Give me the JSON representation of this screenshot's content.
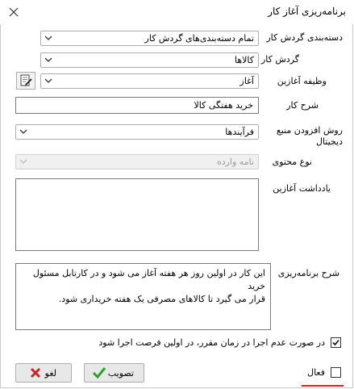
{
  "window": {
    "title": "برنامه‌ریزی آغاز کار"
  },
  "form": {
    "category": {
      "label": "دسته‌بندی گردش کار",
      "value": "تمام دسته‌بندی‌های گردش کار"
    },
    "workflow": {
      "label": "گردش کار",
      "value": "کالاها"
    },
    "start_task": {
      "label": "وظیفه آغازین",
      "value": "آغاز"
    },
    "description": {
      "label": "شرح کار",
      "value": "خرید هفتگی کالا"
    },
    "digital_resource_method": {
      "label": "روش افزودن منبع دیجیتال",
      "value": "فرآیندها"
    },
    "content_type": {
      "label": "نوع محتوی",
      "value": "نامه وارده"
    },
    "start_note": {
      "label": "یادداشت آغازین",
      "value": ""
    },
    "schedule_desc": {
      "label": "شرح برنامه‌ریزی",
      "value": "این کار در اولین روز هر هفته آغاز می شود و در کارتابل مسئول خرید\nقرار می گیرد تا کالاهای مصرفی یک هفته خریداری شود."
    },
    "run_if_missed": {
      "label": "در صورت عدم اجرا در زمان مقرر، در اولین فرصت اجرا شود",
      "checked": true
    },
    "active": {
      "label": "فعال",
      "checked": false
    }
  },
  "buttons": {
    "approve": "تصویب",
    "cancel": "لغو"
  },
  "colors": {
    "approve_check": "#2aa12a",
    "cancel_x": "#c62828",
    "underline": "#e02020"
  }
}
